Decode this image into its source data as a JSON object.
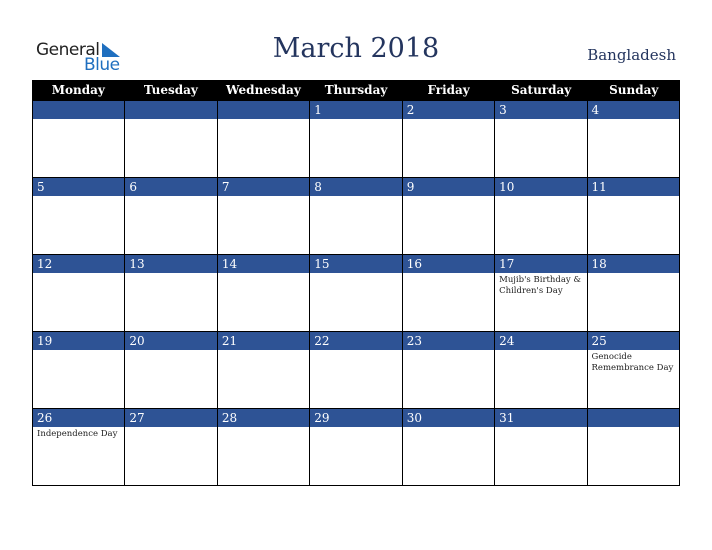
{
  "logo": {
    "line1": "General",
    "line2": "Blue"
  },
  "header": {
    "title": "March 2018",
    "country": "Bangladesh"
  },
  "weekdays": [
    "Monday",
    "Tuesday",
    "Wednesday",
    "Thursday",
    "Friday",
    "Saturday",
    "Sunday"
  ],
  "weeks": [
    [
      {
        "day": "",
        "event": ""
      },
      {
        "day": "",
        "event": ""
      },
      {
        "day": "",
        "event": ""
      },
      {
        "day": "1",
        "event": ""
      },
      {
        "day": "2",
        "event": ""
      },
      {
        "day": "3",
        "event": ""
      },
      {
        "day": "4",
        "event": ""
      }
    ],
    [
      {
        "day": "5",
        "event": ""
      },
      {
        "day": "6",
        "event": ""
      },
      {
        "day": "7",
        "event": ""
      },
      {
        "day": "8",
        "event": ""
      },
      {
        "day": "9",
        "event": ""
      },
      {
        "day": "10",
        "event": ""
      },
      {
        "day": "11",
        "event": ""
      }
    ],
    [
      {
        "day": "12",
        "event": ""
      },
      {
        "day": "13",
        "event": ""
      },
      {
        "day": "14",
        "event": ""
      },
      {
        "day": "15",
        "event": ""
      },
      {
        "day": "16",
        "event": ""
      },
      {
        "day": "17",
        "event": "Mujib's Birthday & Children's Day"
      },
      {
        "day": "18",
        "event": ""
      }
    ],
    [
      {
        "day": "19",
        "event": ""
      },
      {
        "day": "20",
        "event": ""
      },
      {
        "day": "21",
        "event": ""
      },
      {
        "day": "22",
        "event": ""
      },
      {
        "day": "23",
        "event": ""
      },
      {
        "day": "24",
        "event": ""
      },
      {
        "day": "25",
        "event": "Genocide Remembrance Day"
      }
    ],
    [
      {
        "day": "26",
        "event": "Independence Day"
      },
      {
        "day": "27",
        "event": ""
      },
      {
        "day": "28",
        "event": ""
      },
      {
        "day": "29",
        "event": ""
      },
      {
        "day": "30",
        "event": ""
      },
      {
        "day": "31",
        "event": ""
      },
      {
        "day": "",
        "event": ""
      }
    ]
  ],
  "colors": {
    "date_bar": "#2e5395",
    "header_bg": "#000000",
    "title": "#24355e",
    "logo_blue": "#1f6fbf"
  }
}
